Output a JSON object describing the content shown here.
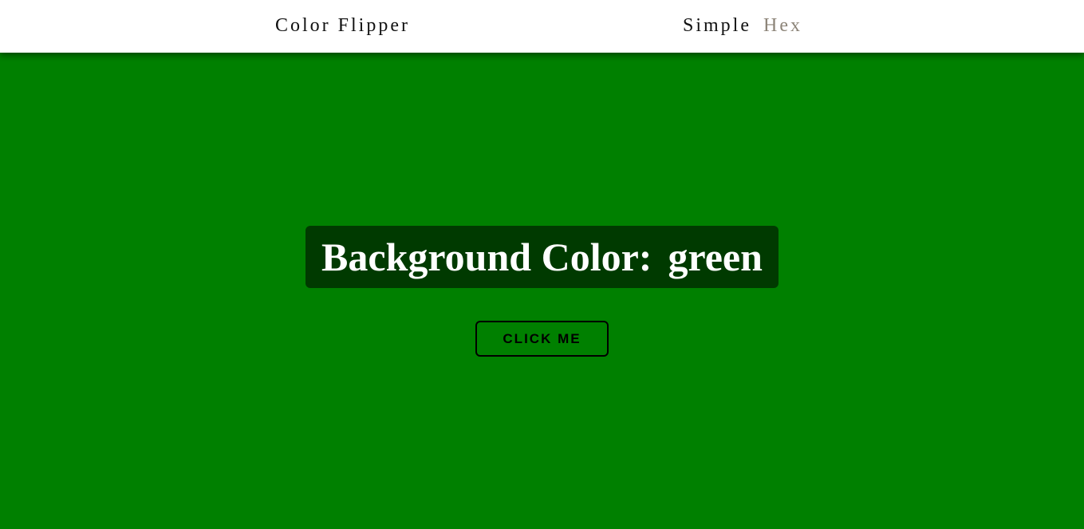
{
  "navbar": {
    "brand": "Color Flipper",
    "links": [
      {
        "label": "Simple",
        "active": true
      },
      {
        "label": "Hex",
        "active": false
      }
    ]
  },
  "main": {
    "background_label": "Background Color:",
    "color_name": "green",
    "button_label": "click me"
  },
  "colors": {
    "background": "#008000",
    "banner": "#003a00",
    "inactive_link": "#8c8478"
  }
}
